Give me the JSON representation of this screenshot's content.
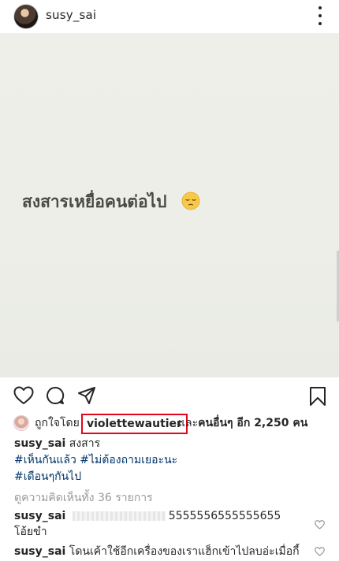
{
  "header": {
    "username": "susy_sai",
    "avatar_icon": "profile-avatar",
    "more_icon": "more-vertical-icon"
  },
  "post": {
    "image_text": "สงสารเหยื่อคนต่อไป",
    "emoji": "pensive-face-emoji"
  },
  "actions": {
    "icons": [
      "heart-icon",
      "comment-icon",
      "share-icon",
      "bookmark-icon"
    ]
  },
  "likes": {
    "liked_by_label": "ถูกใจโดย",
    "liker_name": "violettewautier",
    "and_label": "และ",
    "others_label": "คนอื่นๆ อีก 2,250 คน",
    "highlight_color": "#e3051b"
  },
  "caption": {
    "username": "susy_sai",
    "text": "สงสาร",
    "hashtags_line1": [
      "#เห็นกันแล้ว",
      "#ไม่ต้องถามเยอะนะ"
    ],
    "hashtags_line2": [
      "#เดือนๆกันไป"
    ]
  },
  "view_all_comments": "ดูความคิดเห็นทั้ง 36 รายการ",
  "comments": [
    {
      "username": "susy_sai",
      "text": "5555556555555655",
      "text_line2": "โอ้ยขำ"
    },
    {
      "username": "susy_sai",
      "text": "โดนเค้าใช้อีกเครื่องของเราแฮ็กเข้าไปลบอ่ะเมื่อกี้"
    }
  ],
  "colors": {
    "hashtag": "#003569",
    "muted": "#999999",
    "text": "#262626",
    "post_background": "#eceee7"
  }
}
